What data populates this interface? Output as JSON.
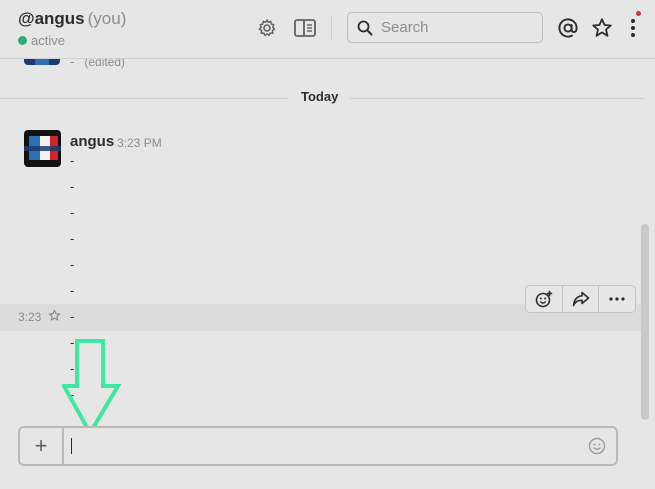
{
  "header": {
    "channel": "@angus",
    "you_label": "(you)",
    "status": "active",
    "search_placeholder": "Search"
  },
  "icons": {
    "settings": "gear-icon",
    "details": "sidebar-panel-icon",
    "mentions": "at-sign-icon",
    "starred": "star-icon",
    "more": "vertical-ellipsis-icon"
  },
  "messages": {
    "prev_line": "-",
    "prev_edited": "(edited)",
    "day_divider": "Today",
    "author": "angus",
    "time": "3:23 PM",
    "lines": [
      "-",
      "-",
      "-",
      "-",
      "-",
      "-",
      "-",
      "-",
      "-",
      "-"
    ],
    "hover_time": "3:23"
  },
  "composer": {
    "plus_label": "+",
    "value": ""
  },
  "colors": {
    "active_dot": "#2bac76",
    "notification_dot": "#c8393e",
    "annotation_arrow": "#3ee8a3"
  }
}
